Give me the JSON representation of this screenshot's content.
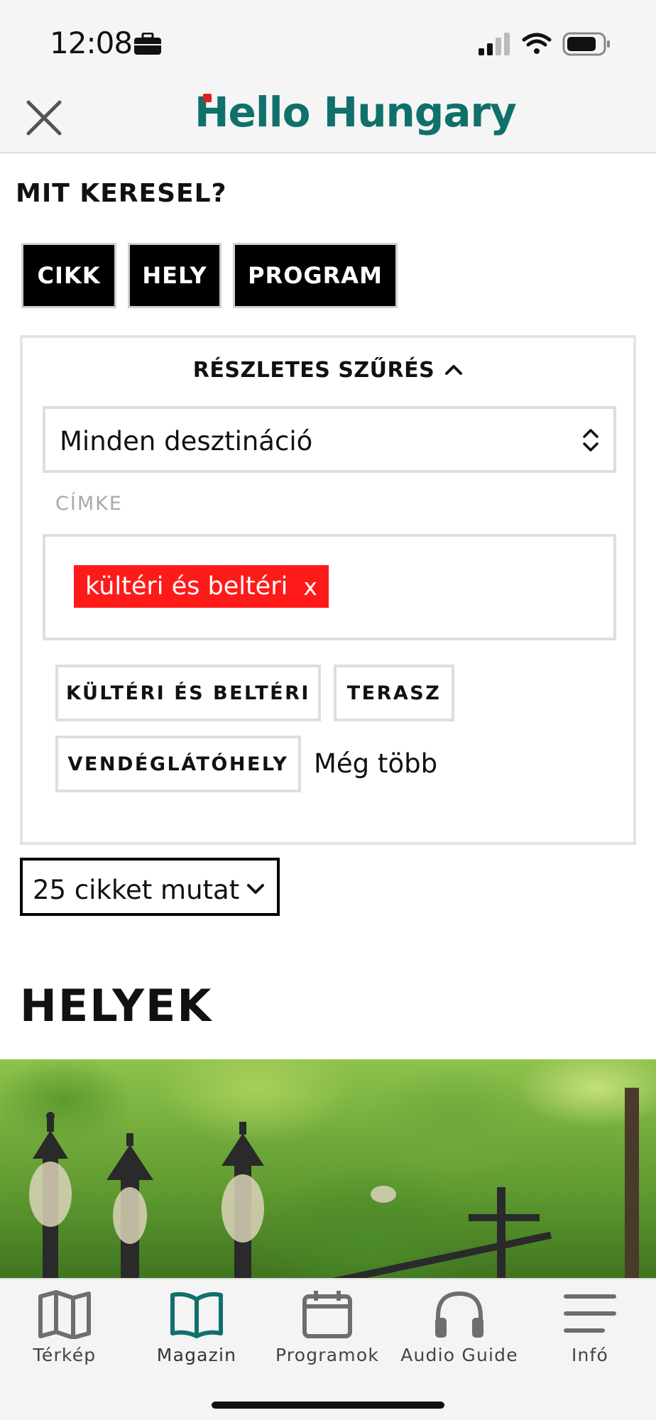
{
  "status": {
    "time": "12:08"
  },
  "header": {
    "logo": "Hello Hungary"
  },
  "search": {
    "title": "MIT KERESEL?"
  },
  "types": [
    {
      "label": "CIKK"
    },
    {
      "label": "HELY"
    },
    {
      "label": "PROGRAM"
    }
  ],
  "filter": {
    "title": "RÉSZLETES SZŰRÉS",
    "destination": "Minden desztináció",
    "tag_label": "CÍMKE",
    "selected_tag": "kültéri és beltéri",
    "remove_symbol": "x",
    "suggestions": [
      "KÜLTÉRI ÉS BELTÉRI",
      "TERASZ",
      "VENDÉGLÁTÓHELY"
    ],
    "more": "Még több"
  },
  "count_select": {
    "value": "25 cikket mutat"
  },
  "section": {
    "title": "HELYEK"
  },
  "tabs": [
    {
      "label": "Térkép",
      "icon": "map-icon"
    },
    {
      "label": "Magazin",
      "icon": "book-icon",
      "active": true
    },
    {
      "label": "Programok",
      "icon": "calendar-icon"
    },
    {
      "label": "Audio Guide",
      "icon": "headphones-icon"
    },
    {
      "label": "Infó",
      "icon": "menu-icon"
    }
  ],
  "colors": {
    "brand": "#10706c",
    "chip": "#ff1a1a",
    "tab_inactive": "#6e6e6e"
  }
}
